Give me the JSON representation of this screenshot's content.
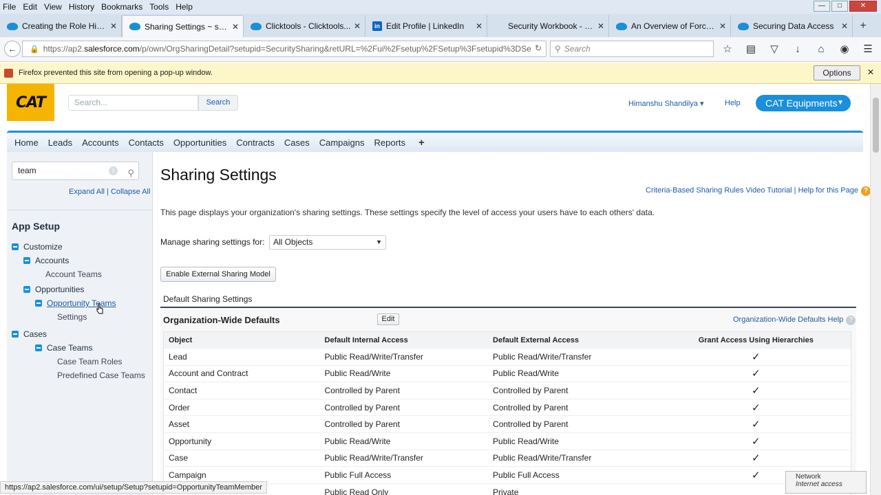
{
  "browser": {
    "menu": [
      "File",
      "Edit",
      "View",
      "History",
      "Bookmarks",
      "Tools",
      "Help"
    ],
    "tabs": [
      {
        "label": "Creating the Role Hier...",
        "icon": "salesforce-cloud-icon",
        "active": false
      },
      {
        "label": "Sharing Settings ~ sal...",
        "icon": "salesforce-cloud-icon",
        "active": true
      },
      {
        "label": "Clicktools - Clicktools...",
        "icon": "salesforce-cloud-icon",
        "active": false
      },
      {
        "label": "Edit Profile | LinkedIn",
        "icon": "linkedin-icon",
        "active": false
      },
      {
        "label": "Security Workbook - work...",
        "icon": "",
        "active": false
      },
      {
        "label": "An Overview of Force....",
        "icon": "salesforce-cloud-icon",
        "active": false
      },
      {
        "label": "Securing Data Access",
        "icon": "salesforce-cloud-icon",
        "active": false
      }
    ],
    "url_prefix": "https://ap2.",
    "url_domain": "salesforce.com",
    "url_rest": "/p/own/OrgSharingDetail?setupid=SecuritySharing&retURL=%2Fui%2Fsetup%2FSetup%3Fsetupid%3DSe",
    "search_placeholder": "Search",
    "popup_message": "Firefox prevented this site from opening a pop-up window.",
    "popup_options": "Options",
    "status_url": "https://ap2.salesforce.com/ui/setup/Setup?setupid=OpportunityTeamMember",
    "network_title": "Network",
    "network_status": "Internet access"
  },
  "sf": {
    "logo_text": "CAT",
    "search_placeholder": "Search...",
    "search_button": "Search",
    "user_name": "Himanshu Shandilya",
    "help": "Help",
    "app_name": "CAT Equipments",
    "nav_tabs": [
      "Home",
      "Leads",
      "Accounts",
      "Contacts",
      "Opportunities",
      "Contracts",
      "Cases",
      "Campaigns",
      "Reports"
    ],
    "nav_plus": "+"
  },
  "sidebar": {
    "quickfind_value": "team",
    "expand_all": "Expand All",
    "collapse_all": "Collapse All",
    "separator": " | ",
    "app_setup": "App Setup",
    "tree": [
      {
        "label": "Customize",
        "level": 0,
        "type": "folder"
      },
      {
        "label": "Accounts",
        "level": 1,
        "type": "folder"
      },
      {
        "label": "Account Teams",
        "level": 2,
        "type": "plain"
      },
      {
        "label": "Opportunities",
        "level": 1,
        "type": "folder"
      },
      {
        "label": "Opportunity Teams",
        "level": 2,
        "type": "link-folder"
      },
      {
        "label": "Settings",
        "level": 3,
        "type": "plain"
      },
      {
        "label": "Cases",
        "level": 0,
        "type": "folder"
      },
      {
        "label": "Case Teams",
        "level": 1,
        "type": "folder"
      },
      {
        "label": "Case Team Roles",
        "level": 3,
        "type": "plain"
      },
      {
        "label": "Predefined Case Teams",
        "level": 3,
        "type": "plain"
      }
    ]
  },
  "main": {
    "title": "Sharing Settings",
    "video_link": "Criteria-Based Sharing Rules Video Tutorial",
    "link_separator": " | ",
    "help_link": "Help for this Page",
    "description": "This page displays your organization's sharing settings. These settings specify the level of access your users have to each others' data.",
    "manage_label": "Manage sharing settings for:",
    "manage_value": "All Objects",
    "external_button": "Enable External Sharing Model",
    "default_heading": "Default Sharing Settings",
    "owd_title": "Organization-Wide Defaults",
    "edit_button": "Edit",
    "owd_help": "Organization-Wide Defaults Help",
    "columns": [
      "Object",
      "Default Internal Access",
      "Default External Access",
      "Grant Access Using Hierarchies"
    ],
    "rows": [
      {
        "object": "Lead",
        "internal": "Public Read/Write/Transfer",
        "external": "Public Read/Write/Transfer",
        "grant": "✓"
      },
      {
        "object": "Account and Contract",
        "internal": "Public Read/Write",
        "external": "Public Read/Write",
        "grant": "✓"
      },
      {
        "object": "Contact",
        "internal": "Controlled by Parent",
        "external": "Controlled by Parent",
        "grant": "✓"
      },
      {
        "object": "Order",
        "internal": "Controlled by Parent",
        "external": "Controlled by Parent",
        "grant": "✓"
      },
      {
        "object": "Asset",
        "internal": "Controlled by Parent",
        "external": "Controlled by Parent",
        "grant": "✓"
      },
      {
        "object": "Opportunity",
        "internal": "Public Read/Write",
        "external": "Public Read/Write",
        "grant": "✓"
      },
      {
        "object": "Case",
        "internal": "Public Read/Write/Transfer",
        "external": "Public Read/Write/Transfer",
        "grant": "✓"
      },
      {
        "object": "Campaign",
        "internal": "Public Full Access",
        "external": "Public Full Access",
        "grant": "✓"
      },
      {
        "object": "",
        "internal": "Public Read Only",
        "external": "Private",
        "grant": ""
      }
    ]
  }
}
